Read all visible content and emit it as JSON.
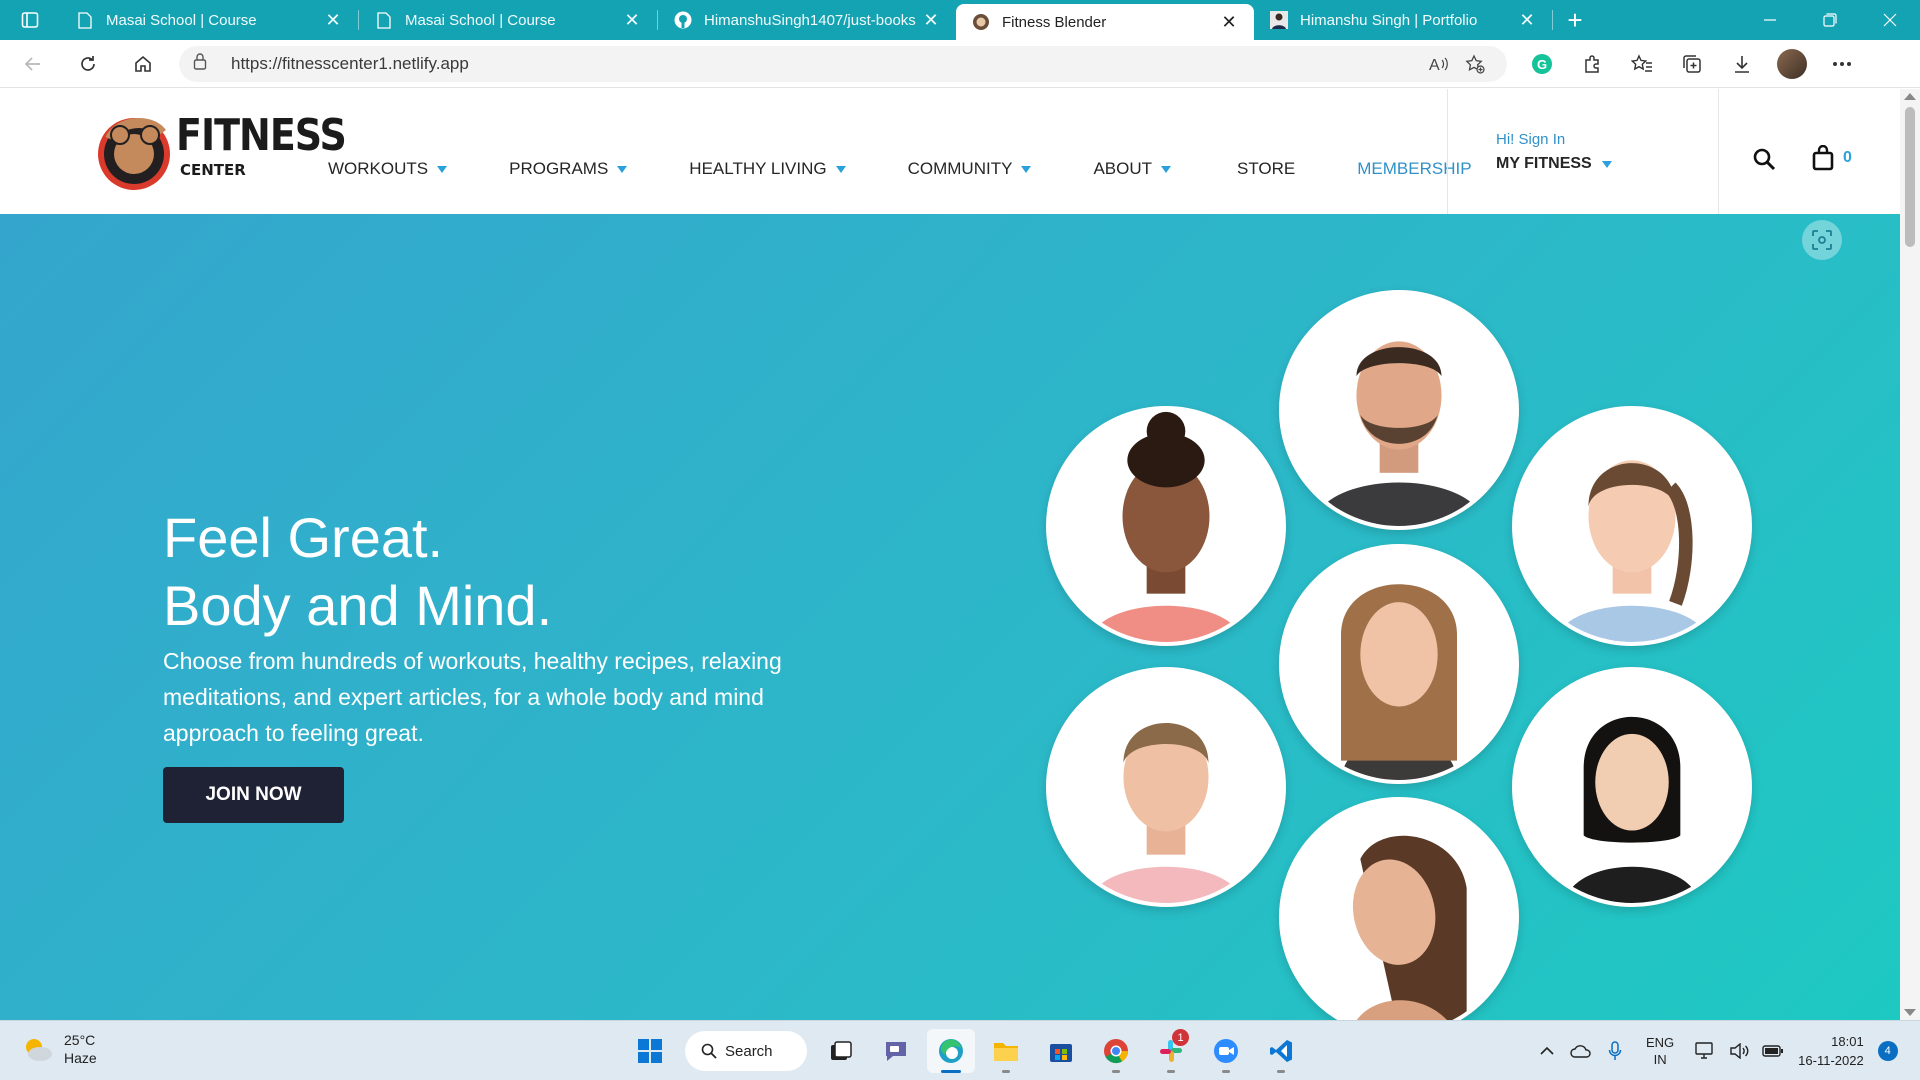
{
  "browser": {
    "tabs": [
      {
        "title": "Masai School | Course",
        "favicon": "page-icon"
      },
      {
        "title": "Masai School | Course",
        "favicon": "page-icon"
      },
      {
        "title": "HimanshuSingh1407/just-books",
        "favicon": "github-icon"
      },
      {
        "title": "Fitness Blender",
        "favicon": "fitness-icon",
        "active": true
      },
      {
        "title": "Himanshu Singh | Portfolio",
        "favicon": "portfolio-icon"
      }
    ],
    "close_glyph": "✕",
    "new_tab_glyph": "+",
    "url": "https://fitnesscenter1.netlify.app"
  },
  "site": {
    "logo": {
      "word": "FITNESS",
      "sub": "CENTER"
    },
    "nav": [
      {
        "label": "WORKOUTS",
        "dropdown": true
      },
      {
        "label": "PROGRAMS",
        "dropdown": true
      },
      {
        "label": "HEALTHY LIVING",
        "dropdown": true
      },
      {
        "label": "COMMUNITY",
        "dropdown": true
      },
      {
        "label": "ABOUT",
        "dropdown": true
      },
      {
        "label": "STORE",
        "dropdown": false
      },
      {
        "label": "MEMBERSHIP",
        "dropdown": false
      }
    ],
    "account": {
      "signin": "Hi! Sign In",
      "my_fitness": "MY FITNESS"
    },
    "cart_count": "0",
    "accent": "#2aa0dc"
  },
  "hero": {
    "headline_1": "Feel Great.",
    "headline_2": "Body and Mind.",
    "subtext": "Choose from hundreds of workouts, healthy recipes, relaxing meditations, and expert articles, for a whole body and mind approach to feeling great.",
    "cta": "JOIN NOW",
    "gradient": [
      "#34a6cd",
      "#1ec9c2"
    ]
  },
  "taskbar": {
    "weather": {
      "temp": "25°C",
      "condition": "Haze"
    },
    "search_label": "Search",
    "slack_badge": "1",
    "lang_1": "ENG",
    "lang_2": "IN",
    "time": "18:01",
    "date": "16-11-2022",
    "notifications": "4"
  }
}
